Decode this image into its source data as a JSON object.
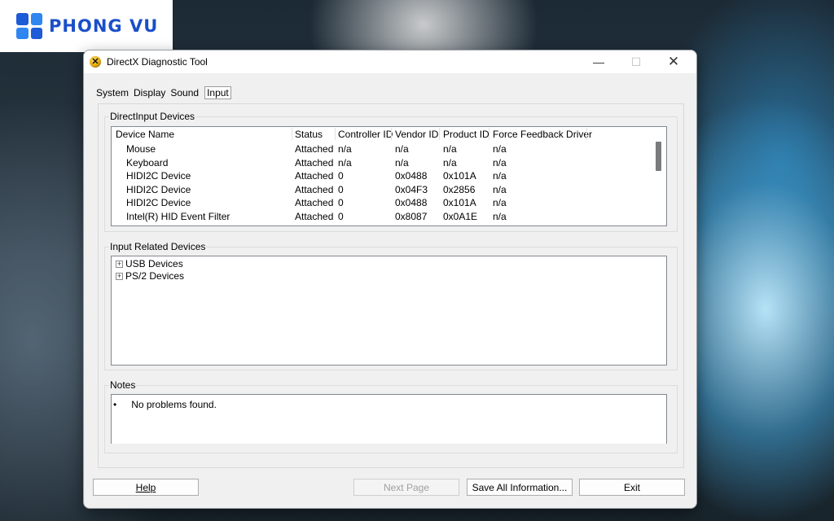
{
  "logo": {
    "text": "PHONG VU"
  },
  "window": {
    "title": "DirectX Diagnostic Tool",
    "controls": {
      "minimize": "—",
      "maximize": "☐",
      "close": "✕"
    }
  },
  "tabs": [
    "System",
    "Display",
    "Sound",
    "Input"
  ],
  "active_tab": "Input",
  "direct_input": {
    "label": "DirectInput Devices",
    "columns": [
      "Device Name",
      "Status",
      "Controller ID",
      "Vendor ID",
      "Product ID",
      "Force Feedback Driver"
    ],
    "rows": [
      [
        "Mouse",
        "Attached",
        "n/a",
        "n/a",
        "n/a",
        "n/a"
      ],
      [
        "Keyboard",
        "Attached",
        "n/a",
        "n/a",
        "n/a",
        "n/a"
      ],
      [
        "HIDI2C Device",
        "Attached",
        "0",
        "0x0488",
        "0x101A",
        "n/a"
      ],
      [
        "HIDI2C Device",
        "Attached",
        "0",
        "0x04F3",
        "0x2856",
        "n/a"
      ],
      [
        "HIDI2C Device",
        "Attached",
        "0",
        "0x0488",
        "0x101A",
        "n/a"
      ],
      [
        "Intel(R) HID Event Filter",
        "Attached",
        "0",
        "0x8087",
        "0x0A1E",
        "n/a"
      ]
    ]
  },
  "input_related": {
    "label": "Input Related Devices",
    "items": [
      "USB Devices",
      "PS/2 Devices"
    ]
  },
  "notes": {
    "label": "Notes",
    "bullet": "•",
    "items": [
      "No problems found."
    ]
  },
  "buttons": {
    "help": "Help",
    "next_page": "Next Page",
    "save_all": "Save All Information...",
    "exit": "Exit"
  }
}
